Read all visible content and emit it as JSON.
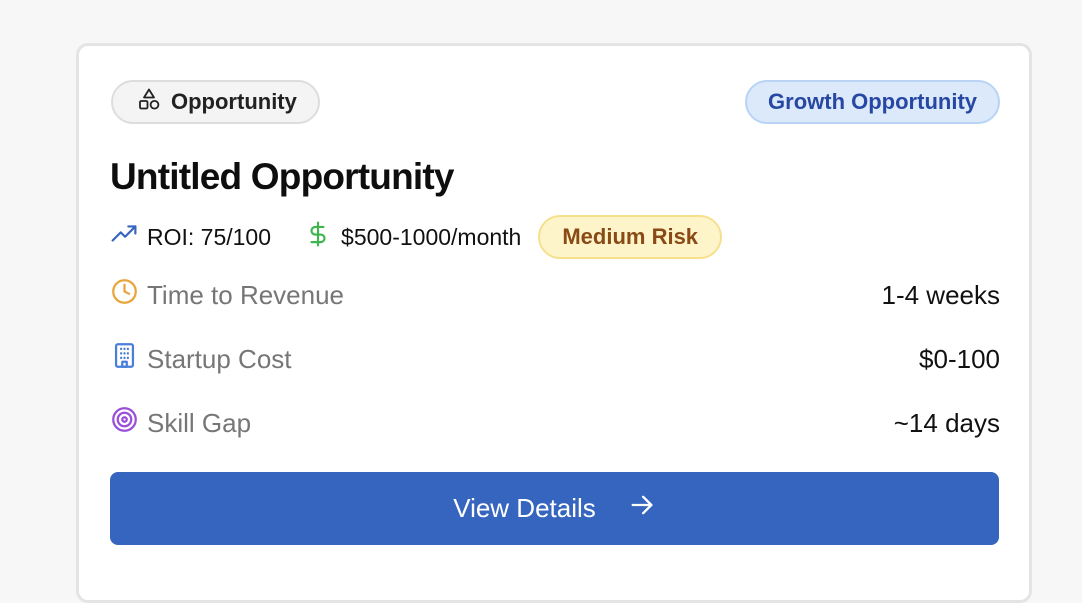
{
  "card": {
    "type_badge": {
      "label": "Opportunity",
      "icon": "shapes-icon"
    },
    "category_badge": {
      "label": "Growth Opportunity",
      "color": "#2747a3",
      "background": "#dbe9fb"
    },
    "title": "Untitled Opportunity",
    "meta": {
      "roi": {
        "label": "ROI: 75/100",
        "icon": "trending-up-icon",
        "icon_color": "#3565be"
      },
      "revenue": {
        "label": "$500-1000/month",
        "icon": "dollar-icon",
        "icon_color": "#3fb550"
      },
      "risk": {
        "label": "Medium Risk",
        "color": "#8a4a16",
        "background": "#fdf4c9"
      }
    },
    "stats": [
      {
        "label": "Time to Revenue",
        "value": "1-4 weeks",
        "icon": "clock-icon",
        "icon_color": "#e8a53a"
      },
      {
        "label": "Startup Cost",
        "value": "$0-100",
        "icon": "building-icon",
        "icon_color": "#4a7fd9"
      },
      {
        "label": "Skill Gap",
        "value": "~14 days",
        "icon": "target-icon",
        "icon_color": "#9b4fd9"
      }
    ],
    "action": {
      "label": "View Details",
      "icon": "arrow-right-icon",
      "background": "#3565be"
    }
  }
}
